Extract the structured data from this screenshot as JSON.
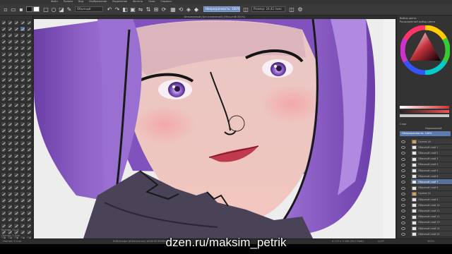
{
  "menubar": {
    "items": [
      "Файл",
      "Правка",
      "Вид",
      "Изображение",
      "Выделение",
      "Фильтр",
      "Окно",
      "Справка"
    ]
  },
  "toolbar": {
    "brush_preset": "Обычный",
    "opacity_field": "Непрозрачность: 100%",
    "size_field": "Размер: 24,42 пикс",
    "primary_color": "#1a1a1a",
    "secondary_color": "#ffffff",
    "accent_color": "#6d8bbf"
  },
  "canvas": {
    "title": "Безымянный [Без изменений] (Масштаб 301%)"
  },
  "left_panel": {
    "size_label": "Размер: 24,42",
    "footer": "Ластик: 5 Спи"
  },
  "right_panel": {
    "color_title": "Выбор цвета",
    "brush_title": "Расширенный выбор цвета",
    "layers_title": "Слои",
    "blend_label": "Нормальный",
    "opacity_label": "Непрозрачность: 100%",
    "layers": [
      {
        "name": "Группа 18",
        "type": "folder"
      },
      {
        "name": "Обычный слой 1",
        "type": "paint"
      },
      {
        "name": "Обычный слой 2",
        "type": "paint"
      },
      {
        "name": "Обычный слой 3",
        "type": "paint"
      },
      {
        "name": "Обычный слой 4",
        "type": "paint"
      },
      {
        "name": "Обычный слой 5",
        "type": "paint"
      },
      {
        "name": "Обычный слой 6",
        "type": "paint"
      },
      {
        "name": "Обычный слой 7",
        "type": "paint"
      },
      {
        "name": "Обычный слой 8",
        "type": "paint"
      },
      {
        "name": "Группа 14",
        "type": "folder"
      },
      {
        "name": "Обычный слой 9",
        "type": "paint"
      },
      {
        "name": "Обычный слой 10",
        "type": "paint"
      },
      {
        "name": "Обычный слой 11",
        "type": "paint"
      },
      {
        "name": "Обычный слой 12",
        "type": "paint"
      },
      {
        "name": "Обычный слой 13",
        "type": "paint"
      },
      {
        "name": "Обычный слой 14",
        "type": "paint"
      },
      {
        "name": "Обычный слой 15",
        "type": "paint"
      }
    ]
  },
  "statusbar": {
    "left": "Ластик: 5 Спи",
    "center": "RGB/Альфа (8-бит/канал)  sRGB IEC61966-2.1",
    "right_size": "4 172 x 3 458 (55,0 МиБ)",
    "angle": "0,00°",
    "zoom": "301%"
  },
  "watermark": "dzen.ru/maksim_petrik"
}
